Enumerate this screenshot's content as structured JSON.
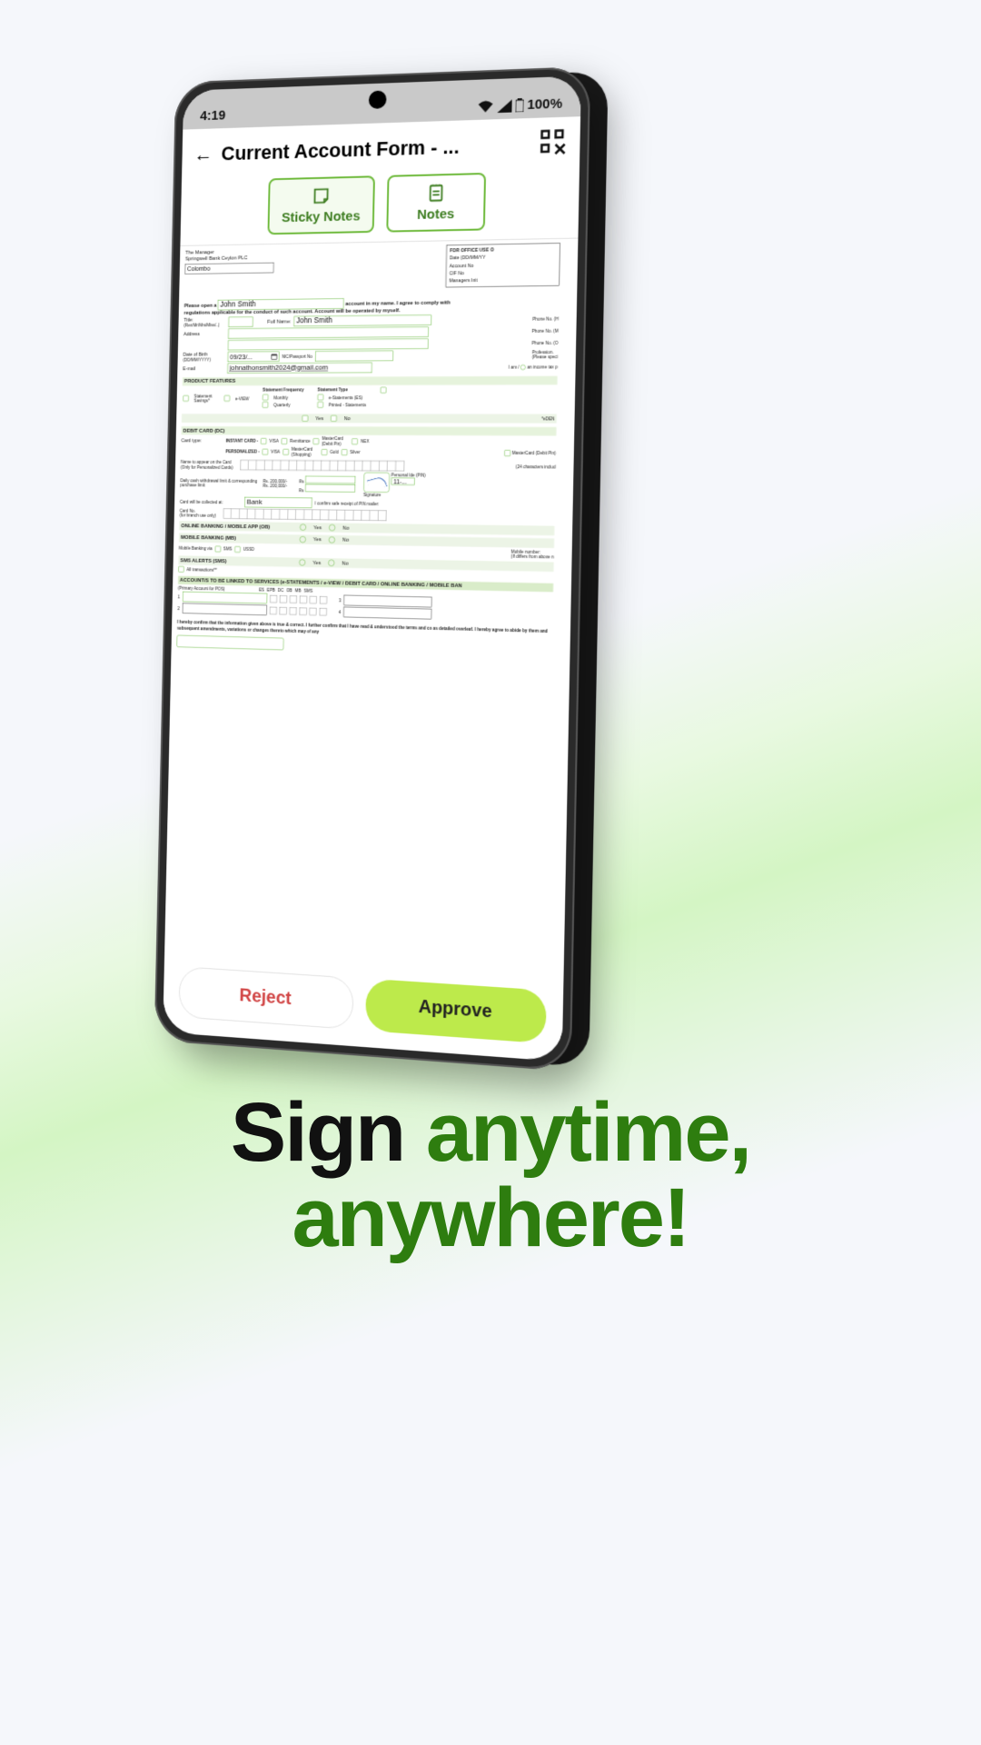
{
  "status": {
    "time": "4:19",
    "battery": "100%"
  },
  "header": {
    "title": "Current Account Form - ..."
  },
  "tabs": {
    "sticky": "Sticky Notes",
    "notes": "Notes"
  },
  "form": {
    "addressee": "The Manager",
    "bank": "Springwell Bank Ceylon PLC",
    "city": "Colombo",
    "office_box_title": "FOR OFFICE USE O",
    "office_fields": [
      "Date (DD/MM/YY",
      "Account No",
      "CIF No",
      "Managers Init"
    ],
    "open_prefix": "Please open a",
    "open_name": "John Smith",
    "open_suffix": "account in my name. I agree to comply with",
    "open_line2": "regulations applicable for the conduct of such account. Account will be operated by myself.",
    "title_label": "Title:",
    "title_sub": "(Rev/Mr/Mrs/Miss/..)",
    "fullname_label": "Full Name:",
    "fullname": "John Smith",
    "address_label": "Address",
    "phone_h": "Phone No. (H",
    "phone_m": "Phone No. (M",
    "phone_o": "Phone No. (O",
    "dob_label": "Date of Birth",
    "dob_sub": "(DD/MM/YYYY)",
    "dob": "09/23/...",
    "nic_label": "NIC/Passport No",
    "profession_label": "Profession.",
    "profession_sub": "(Please speci",
    "email_label": "E-mail",
    "email": "johnathonsmith2024@gmail.com",
    "income_text": "I am / an income tax p",
    "sections": {
      "features": "PRODUCT FEATURES",
      "debit": "DEBIT CARD (DC)",
      "online": "ONLINE BANKING / MOBILE APP (OB)",
      "mobile": "MOBILE BANKING (MB)",
      "sms": "SMS ALERTS (SMS)",
      "linked": "ACCOUNT/S TO BE LINKED TO SERVICES (e-STATEMENTS / e-VIEW / DEBIT CARD / ONLINE BANKING / MOBILE BAN"
    },
    "features": {
      "stmt_savings": "Statement Savings*",
      "eview": "e-VIEW",
      "freq_label": "Statement Frequency",
      "freq_monthly": "Monthly",
      "freq_quarterly": "Quarterly",
      "type_label": "Statement Type",
      "type_es": "e-Statements (ES)",
      "type_printed": "Printed - Statements",
      "eden": "*eDEN"
    },
    "yes": "Yes",
    "no": "No",
    "debit": {
      "card_type": "Card type:",
      "instant": "INSTANT CARD -",
      "personalized": "PERSONALIZED -",
      "visa": "VISA",
      "remittance": "Remittance",
      "mcdebit": "MasterCard (Debit Pin)",
      "nex": "NEX",
      "mc_shopping": "MasterCard (Shopping)",
      "gold": "Gold",
      "silver": "Silver",
      "name_label": "Name to appear on the Card",
      "name_sub": "(Only for Personalized Cards)",
      "chars": "(24 characters includ",
      "limit_label": "Daily cash withdrawal limit & corresponding purchase limit:",
      "limit1": "Rs. 200,000/-",
      "limit2": "Rs. 200,000/-",
      "rs": "Rs",
      "pin": "Personal Ide (PIN)",
      "sig": "Signature",
      "eleven": "11-...",
      "collect_label": "Card will be collected at:",
      "collect_val": "Bank",
      "confirm": "I confirm safe receipt of    PIN mailer:",
      "cardno_label": "Card No.",
      "cardno_sub": "(for branch use only)"
    },
    "mobile": {
      "via": "Mobile Banking via",
      "sms": "SMS",
      "ussd": "USSD",
      "num": "Mobile number:",
      "num_sub": "(If differs from above n"
    },
    "sms": {
      "all": "All transactions**"
    },
    "linked": {
      "primary": "(Primary Account for POS)",
      "cols": [
        "ES",
        "EPB",
        "DC",
        "OB",
        "MB",
        "SMS"
      ]
    },
    "declaration": "I hereby confirm that the information given above is true & correct. I further confirm that I have read & understood the terms and co as detailed overleaf. I hereby agree to abide by them and subsequent amendments, variations or changes thereto which may of any"
  },
  "actions": {
    "reject": "Reject",
    "approve": "Approve"
  },
  "headline": {
    "l1a": "Sign ",
    "l1b": "anytime,",
    "l2": "anywhere!"
  }
}
